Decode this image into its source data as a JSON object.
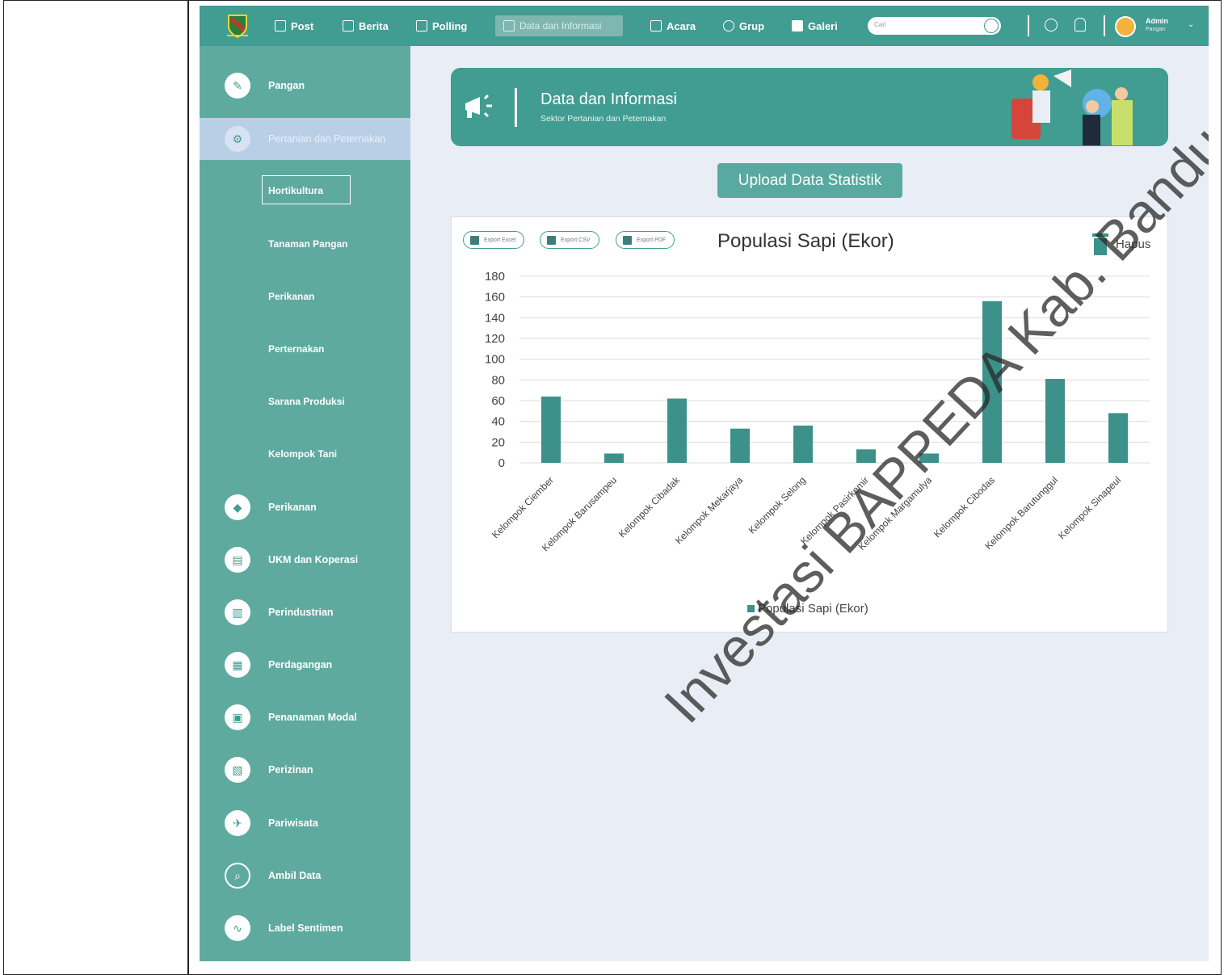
{
  "topnav": {
    "items": [
      {
        "label": "Post",
        "icon": "post-icon"
      },
      {
        "label": "Berita",
        "icon": "news-icon"
      },
      {
        "label": "Polling",
        "icon": "chart-icon"
      },
      {
        "label": "Data dan Informasi",
        "icon": "list-icon",
        "active": true
      },
      {
        "label": "Acara",
        "icon": "calendar-icon"
      },
      {
        "label": "Grup",
        "icon": "group-icon"
      },
      {
        "label": "Galeri",
        "icon": "image-icon"
      }
    ],
    "search_placeholder": "Cari",
    "user_name": "Admin",
    "user_role": "Pangan"
  },
  "sidebar": {
    "items": [
      {
        "label": "Pangan",
        "icon": "leaf-icon"
      },
      {
        "label": "Pertanian dan Peternakan",
        "icon": "tractor-icon",
        "active": true
      },
      {
        "label": "Perikanan",
        "icon": "fish-icon"
      },
      {
        "label": "UKM dan Koperasi",
        "icon": "shop-icon"
      },
      {
        "label": "Perindustrian",
        "icon": "factory-icon"
      },
      {
        "label": "Perdagangan",
        "icon": "market-icon"
      },
      {
        "label": "Penanaman Modal",
        "icon": "briefcase-icon"
      },
      {
        "label": "Perizinan",
        "icon": "license-icon"
      },
      {
        "label": "Pariwisata",
        "icon": "tourism-icon"
      },
      {
        "label": "Ambil Data",
        "icon": "data-search-icon"
      },
      {
        "label": "Label Sentimen",
        "icon": "sentiment-icon"
      }
    ],
    "subitems": [
      "Hortikultura",
      "Tanaman Pangan",
      "Perikanan",
      "Perternakan",
      "Sarana Produksi",
      "Kelompok Tani"
    ]
  },
  "banner": {
    "title": "Data dan Informasi",
    "subtitle": "Sektor Pertanian dan Peternakan"
  },
  "upload_button": "Upload Data Statistik",
  "export_buttons": [
    "Export Excel",
    "Export CSV",
    "Export PDF"
  ],
  "delete_label": "Hapus",
  "watermark": "Investasi BAPPEDA Kab. Bandung",
  "colors": {
    "accent": "#419c91",
    "bar": "#3c918a",
    "sidebar": "#5faa9f",
    "active_sidebar": "#b9cfe6"
  },
  "chart_data": {
    "type": "bar",
    "title": "Populasi Sapi (Ekor)",
    "categories": [
      "Kelompok Ciember",
      "Kelompok Barusampeu",
      "Kelompok Cibadak",
      "Kelompok Mekarjaya",
      "Kelompok Selong",
      "Kelompok Pasirkemir",
      "Kelompok Margamulya",
      "Kelompok Cibodas",
      "Kelompok Barutunggul",
      "Kelompok Sinapeul"
    ],
    "series": [
      {
        "name": "Populasi Sapi (Ekor)",
        "values": [
          64,
          9,
          62,
          33,
          36,
          13,
          9,
          156,
          81,
          48
        ]
      }
    ],
    "yticks": [
      "0",
      "20",
      "40",
      "60",
      "80",
      "100",
      "120",
      "140",
      "160",
      "180"
    ],
    "ylim": [
      0,
      180
    ],
    "grid": true,
    "legend": "bottom"
  }
}
